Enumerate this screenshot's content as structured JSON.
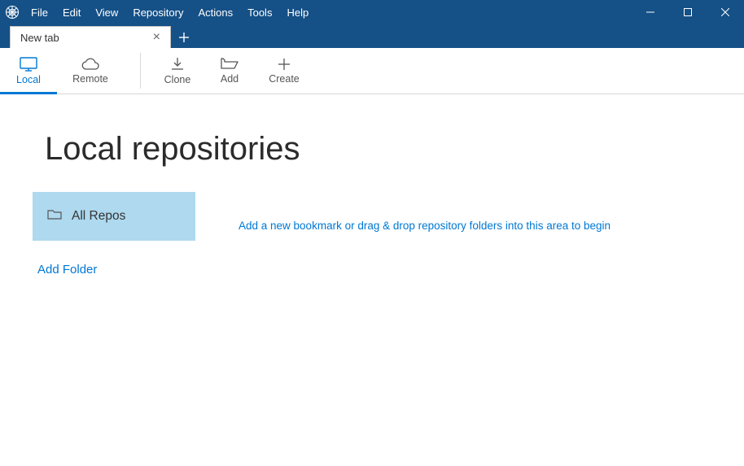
{
  "menu": {
    "file": "File",
    "edit": "Edit",
    "view": "View",
    "repository": "Repository",
    "actions": "Actions",
    "tools": "Tools",
    "help": "Help"
  },
  "tabs": {
    "active": "New tab"
  },
  "toolbar": {
    "local": "Local",
    "remote": "Remote",
    "clone": "Clone",
    "add": "Add",
    "create": "Create"
  },
  "page": {
    "title": "Local repositories",
    "all_repos": "All Repos",
    "add_folder": "Add Folder",
    "hint": "Add a new bookmark or drag & drop repository folders into this area to begin"
  }
}
